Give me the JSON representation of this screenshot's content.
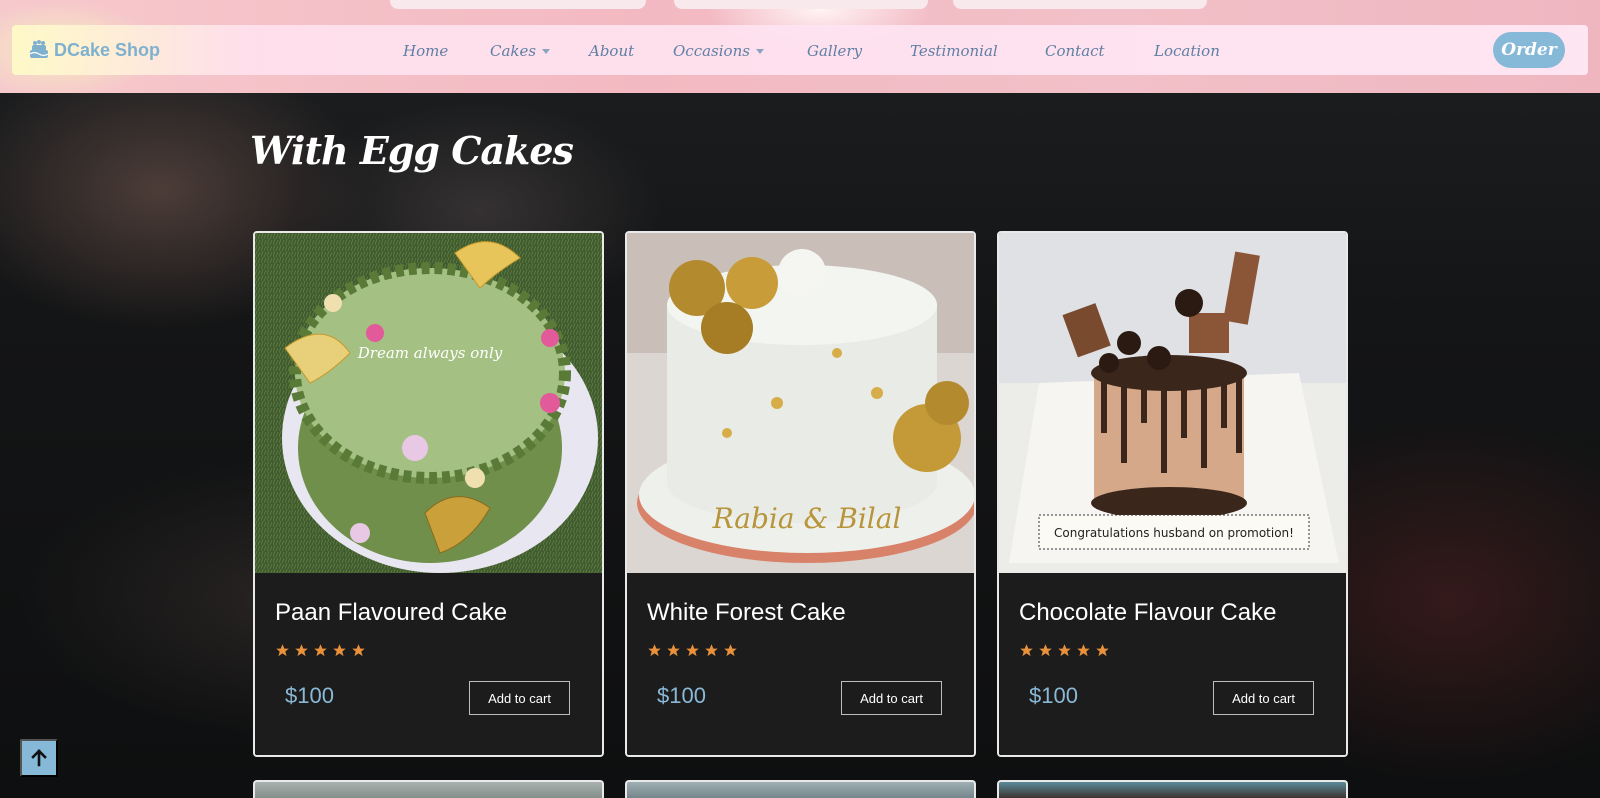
{
  "brand": {
    "name": "DCake Shop",
    "icon": "cake-icon"
  },
  "nav": {
    "items": [
      {
        "label": "Home",
        "dropdown": false
      },
      {
        "label": "Cakes",
        "dropdown": true
      },
      {
        "label": "About",
        "dropdown": false
      },
      {
        "label": "Occasions",
        "dropdown": true
      },
      {
        "label": "Gallery",
        "dropdown": false
      },
      {
        "label": "Testimonial",
        "dropdown": false
      },
      {
        "label": "Contact",
        "dropdown": false
      },
      {
        "label": "Location",
        "dropdown": false
      }
    ],
    "order_label": "Order"
  },
  "section": {
    "title": "With Egg Cakes"
  },
  "products": [
    {
      "name": "Paan Flavoured Cake",
      "rating": 5,
      "price": "$100",
      "cart_label": "Add to cart"
    },
    {
      "name": "White Forest Cake",
      "rating": 5,
      "price": "$100",
      "cart_label": "Add to cart"
    },
    {
      "name": "Chocolate Flavour Cake",
      "rating": 5,
      "price": "$100",
      "cart_label": "Add to cart"
    }
  ],
  "cake_text": {
    "paan": "Dream always only",
    "white_forest": "Rabia & Bilal",
    "chocolate": "Congratulations husband on promotion!"
  },
  "colors": {
    "accent": "#86b8d8",
    "star": "#e8913a",
    "price": "#8ab9d6",
    "nav_text": "#5f7fa3"
  },
  "scroll_top": {
    "icon": "arrow-up-icon"
  }
}
